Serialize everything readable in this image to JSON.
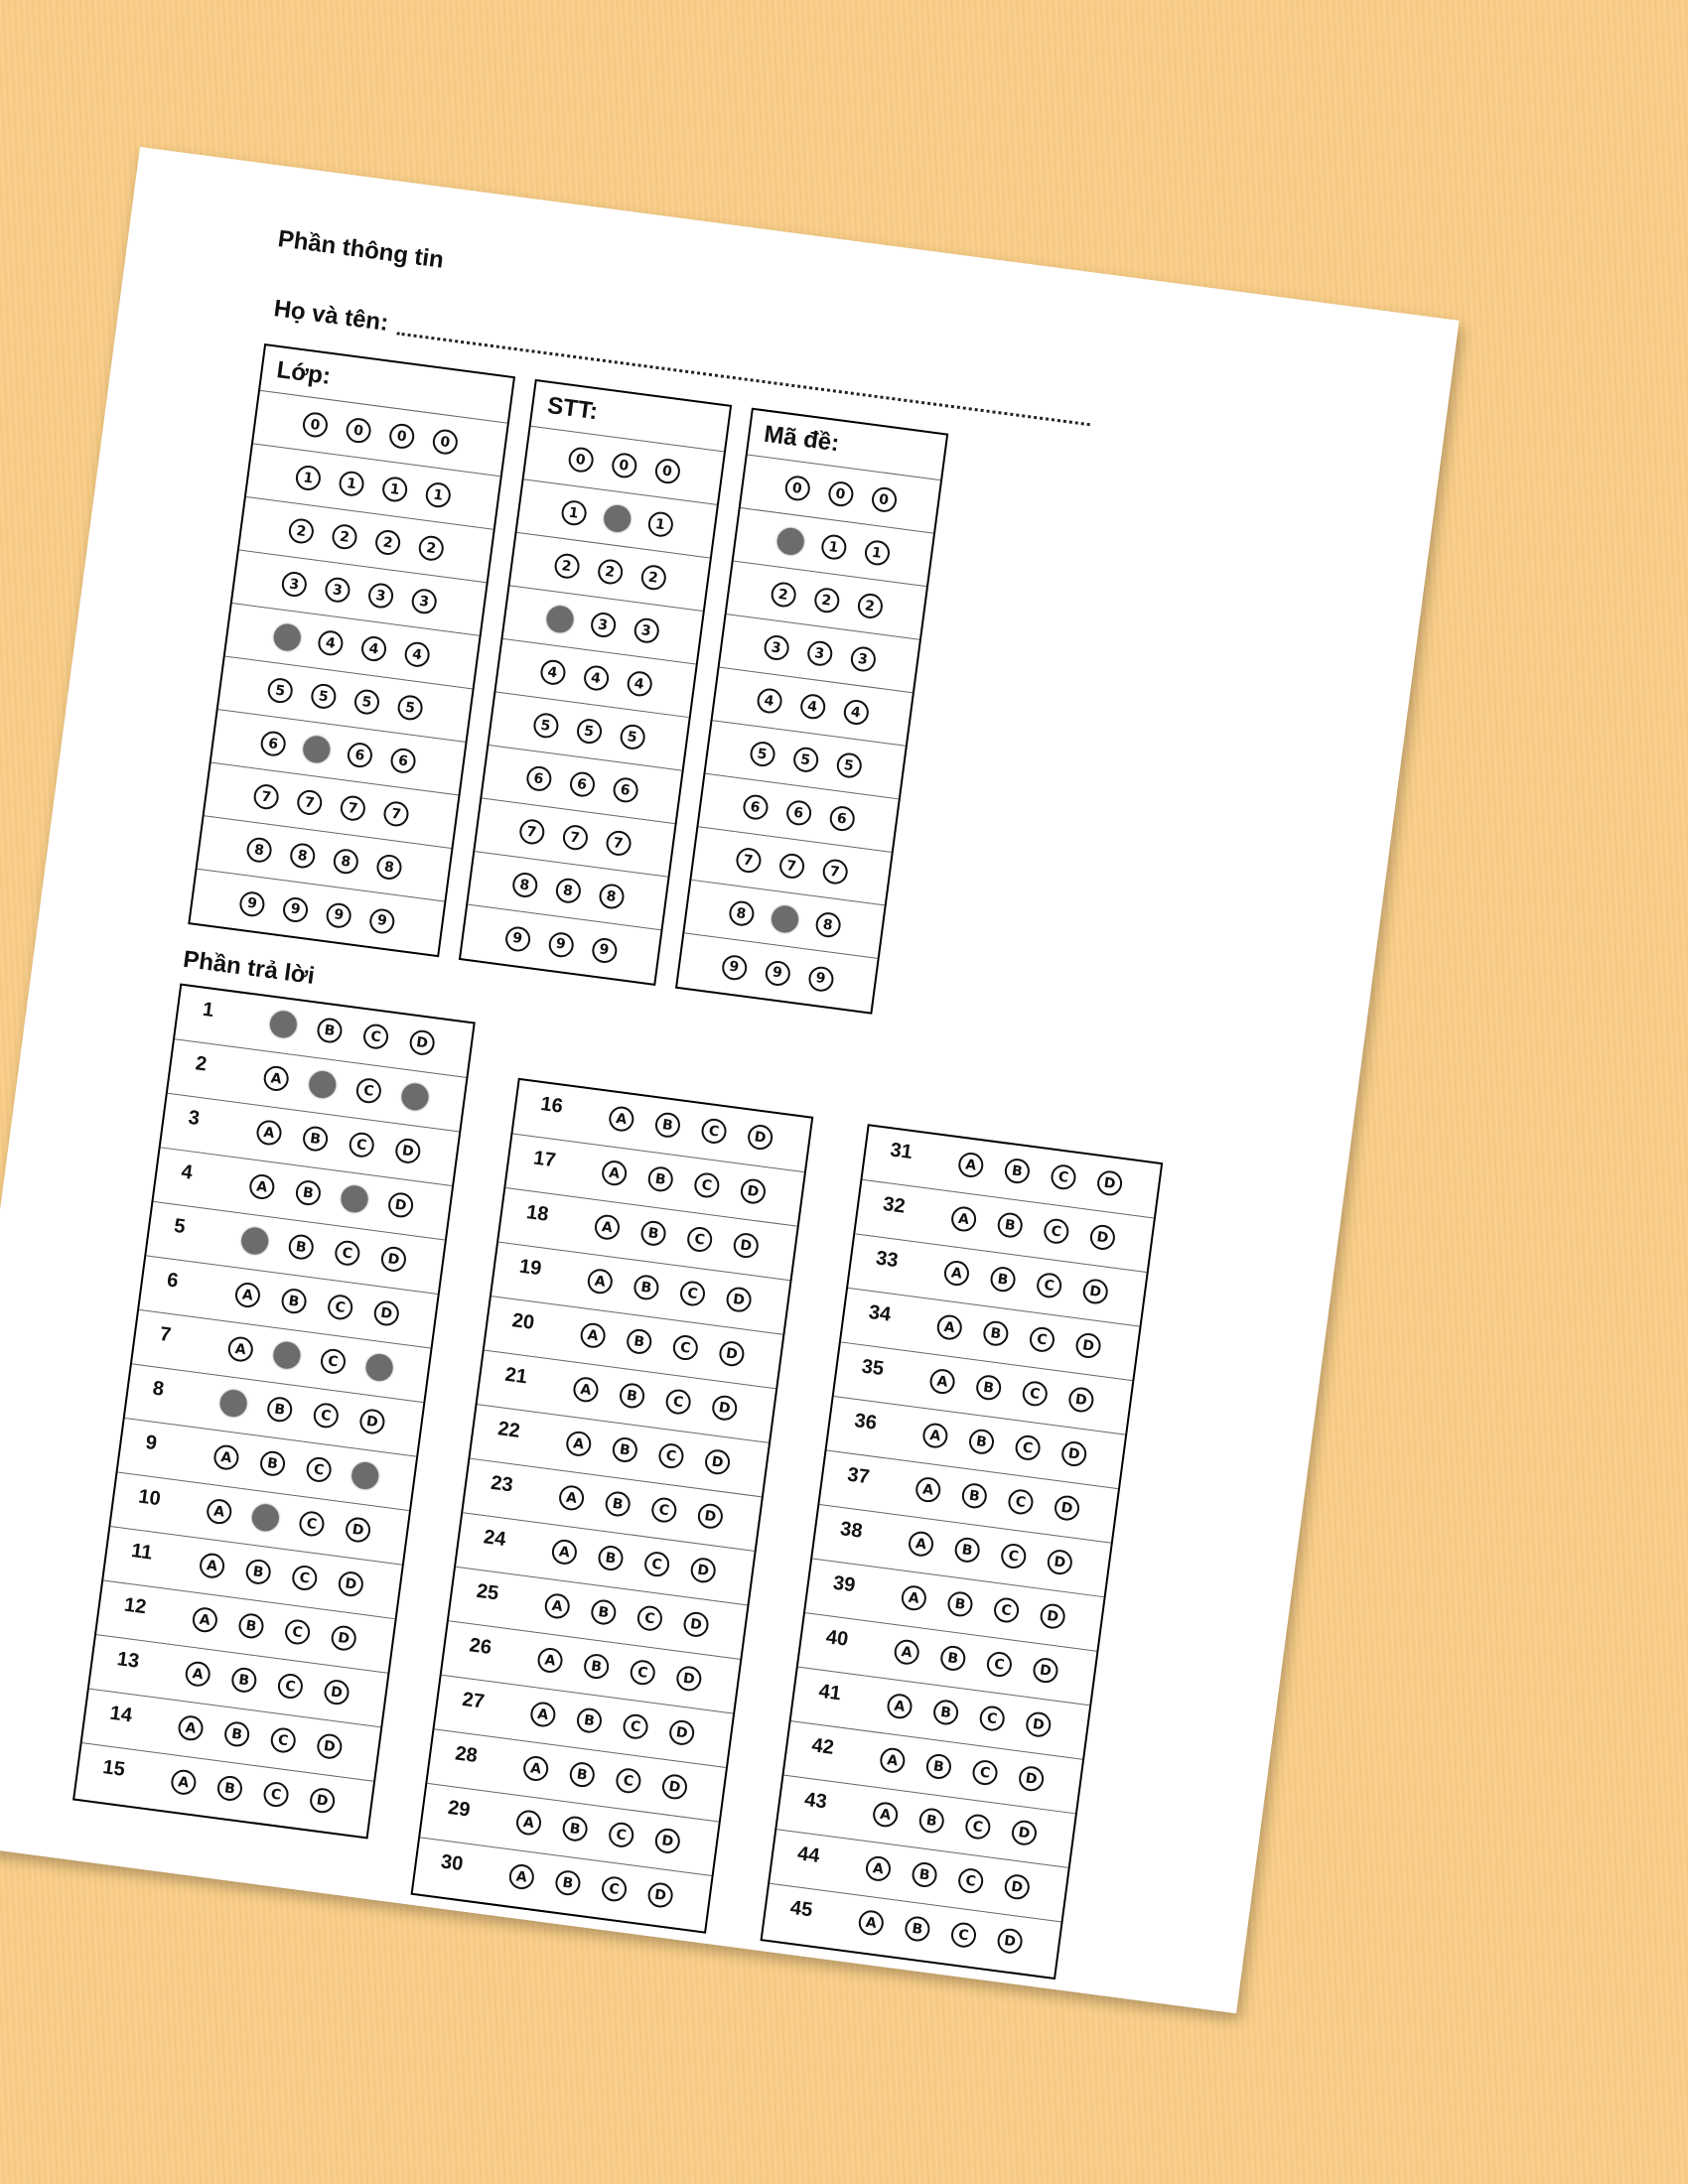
{
  "sheet": {
    "info_heading": "Phần thông tin",
    "name_label": "Họ và tên:",
    "answer_heading": "Phần trả lời"
  },
  "info_boxes": [
    {
      "title": "Lớp:",
      "columns": 4,
      "rows": [
        {
          "digit": "0",
          "filled": []
        },
        {
          "digit": "1",
          "filled": []
        },
        {
          "digit": "2",
          "filled": []
        },
        {
          "digit": "3",
          "filled": []
        },
        {
          "digit": "4",
          "filled": [
            0
          ]
        },
        {
          "digit": "5",
          "filled": []
        },
        {
          "digit": "6",
          "filled": [
            1
          ]
        },
        {
          "digit": "7",
          "filled": []
        },
        {
          "digit": "8",
          "filled": []
        },
        {
          "digit": "9",
          "filled": []
        }
      ]
    },
    {
      "title": "STT:",
      "columns": 3,
      "rows": [
        {
          "digit": "0",
          "filled": []
        },
        {
          "digit": "1",
          "filled": [
            1
          ]
        },
        {
          "digit": "2",
          "filled": []
        },
        {
          "digit": "3",
          "filled": [
            0
          ]
        },
        {
          "digit": "4",
          "filled": []
        },
        {
          "digit": "5",
          "filled": []
        },
        {
          "digit": "6",
          "filled": []
        },
        {
          "digit": "7",
          "filled": []
        },
        {
          "digit": "8",
          "filled": []
        },
        {
          "digit": "9",
          "filled": []
        }
      ]
    },
    {
      "title": "Mã đề:",
      "columns": 3,
      "rows": [
        {
          "digit": "0",
          "filled": []
        },
        {
          "digit": "1",
          "filled": [
            0
          ]
        },
        {
          "digit": "2",
          "filled": []
        },
        {
          "digit": "3",
          "filled": []
        },
        {
          "digit": "4",
          "filled": []
        },
        {
          "digit": "5",
          "filled": []
        },
        {
          "digit": "6",
          "filled": []
        },
        {
          "digit": "7",
          "filled": []
        },
        {
          "digit": "8",
          "filled": [
            1
          ]
        },
        {
          "digit": "9",
          "filled": []
        }
      ]
    }
  ],
  "options": [
    "A",
    "B",
    "C",
    "D"
  ],
  "answers": [
    {
      "q": "1",
      "filled": [
        "A"
      ]
    },
    {
      "q": "2",
      "filled": [
        "B",
        "D"
      ]
    },
    {
      "q": "3",
      "filled": []
    },
    {
      "q": "4",
      "filled": [
        "C"
      ]
    },
    {
      "q": "5",
      "filled": [
        "A"
      ]
    },
    {
      "q": "6",
      "filled": []
    },
    {
      "q": "7",
      "filled": [
        "B",
        "D"
      ]
    },
    {
      "q": "8",
      "filled": [
        "A"
      ]
    },
    {
      "q": "9",
      "filled": [
        "D"
      ]
    },
    {
      "q": "10",
      "filled": [
        "B"
      ]
    },
    {
      "q": "11",
      "filled": []
    },
    {
      "q": "12",
      "filled": []
    },
    {
      "q": "13",
      "filled": []
    },
    {
      "q": "14",
      "filled": []
    },
    {
      "q": "15",
      "filled": []
    },
    {
      "q": "16",
      "filled": []
    },
    {
      "q": "17",
      "filled": []
    },
    {
      "q": "18",
      "filled": []
    },
    {
      "q": "19",
      "filled": []
    },
    {
      "q": "20",
      "filled": []
    },
    {
      "q": "21",
      "filled": []
    },
    {
      "q": "22",
      "filled": []
    },
    {
      "q": "23",
      "filled": []
    },
    {
      "q": "24",
      "filled": []
    },
    {
      "q": "25",
      "filled": []
    },
    {
      "q": "26",
      "filled": []
    },
    {
      "q": "27",
      "filled": []
    },
    {
      "q": "28",
      "filled": []
    },
    {
      "q": "29",
      "filled": []
    },
    {
      "q": "30",
      "filled": []
    },
    {
      "q": "31",
      "filled": []
    },
    {
      "q": "32",
      "filled": []
    },
    {
      "q": "33",
      "filled": []
    },
    {
      "q": "34",
      "filled": []
    },
    {
      "q": "35",
      "filled": []
    },
    {
      "q": "36",
      "filled": []
    },
    {
      "q": "37",
      "filled": []
    },
    {
      "q": "38",
      "filled": []
    },
    {
      "q": "39",
      "filled": []
    },
    {
      "q": "40",
      "filled": []
    },
    {
      "q": "41",
      "filled": []
    },
    {
      "q": "42",
      "filled": []
    },
    {
      "q": "43",
      "filled": []
    },
    {
      "q": "44",
      "filled": []
    },
    {
      "q": "45",
      "filled": []
    }
  ],
  "colors": {
    "background": "#f9cd86",
    "paper": "#ffffff",
    "filled_bubble": "#6c6c6c"
  }
}
